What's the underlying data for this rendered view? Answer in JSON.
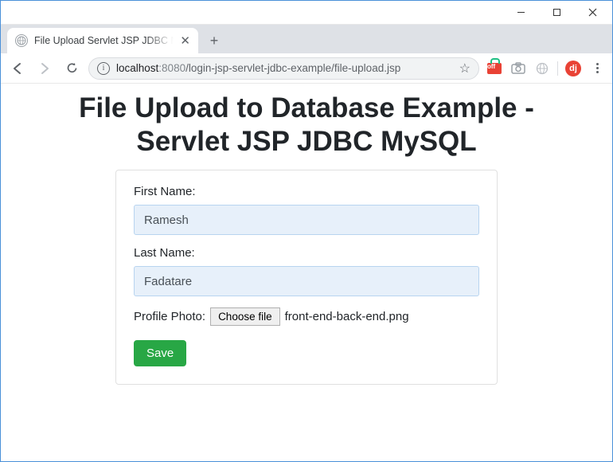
{
  "window": {
    "minimize": "—",
    "maximize": "▢",
    "close": "✕"
  },
  "tab": {
    "title": "File Upload Servlet JSP JDBC MySQL",
    "close": "✕"
  },
  "toolbar": {
    "url_host": "localhost",
    "url_port": ":8080",
    "url_path": "/login-jsp-servlet-jdbc-example/file-upload.jsp",
    "ext_off_label": "off",
    "avatar_initial": "dj"
  },
  "page": {
    "heading": "File Upload to Database Example - Servlet JSP JDBC MySQL",
    "form": {
      "first_name_label": "First Name:",
      "first_name_value": "Ramesh",
      "last_name_label": "Last Name:",
      "last_name_value": "Fadatare",
      "photo_label": "Profile Photo:",
      "choose_file_label": "Choose file",
      "chosen_file_name": "front-end-back-end.png",
      "submit_label": "Save"
    }
  }
}
